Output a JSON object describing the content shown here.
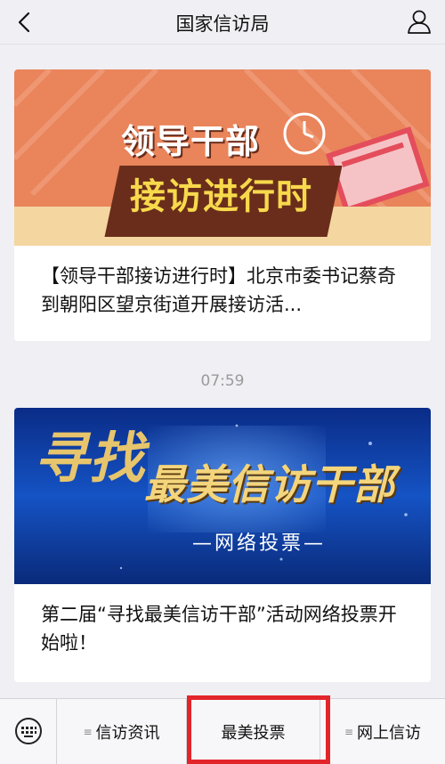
{
  "header": {
    "title": "国家信访局",
    "back_icon": "chevron-left-icon",
    "user_icon": "user-icon"
  },
  "articles": [
    {
      "banner_line1": "领导干部",
      "banner_line2": "接访进行时",
      "title": "【领导干部接访进行时】北京市委书记蔡奇到朝阳区望京街道开展接访活..."
    },
    {
      "banner_big": "最美信访干部",
      "banner_left": "寻找",
      "banner_sub": "—网络投票—",
      "title": "第二届“寻找最美信访干部”活动网络投票开始啦！"
    }
  ],
  "timestamp": "07:59",
  "menu": {
    "keyboard_icon": "keyboard-icon",
    "items": [
      {
        "label": "信访资讯",
        "has_submenu": true
      },
      {
        "label": "最美投票",
        "has_submenu": false
      },
      {
        "label": "网上信访",
        "has_submenu": true
      }
    ],
    "highlight_color": "#e2252b"
  }
}
